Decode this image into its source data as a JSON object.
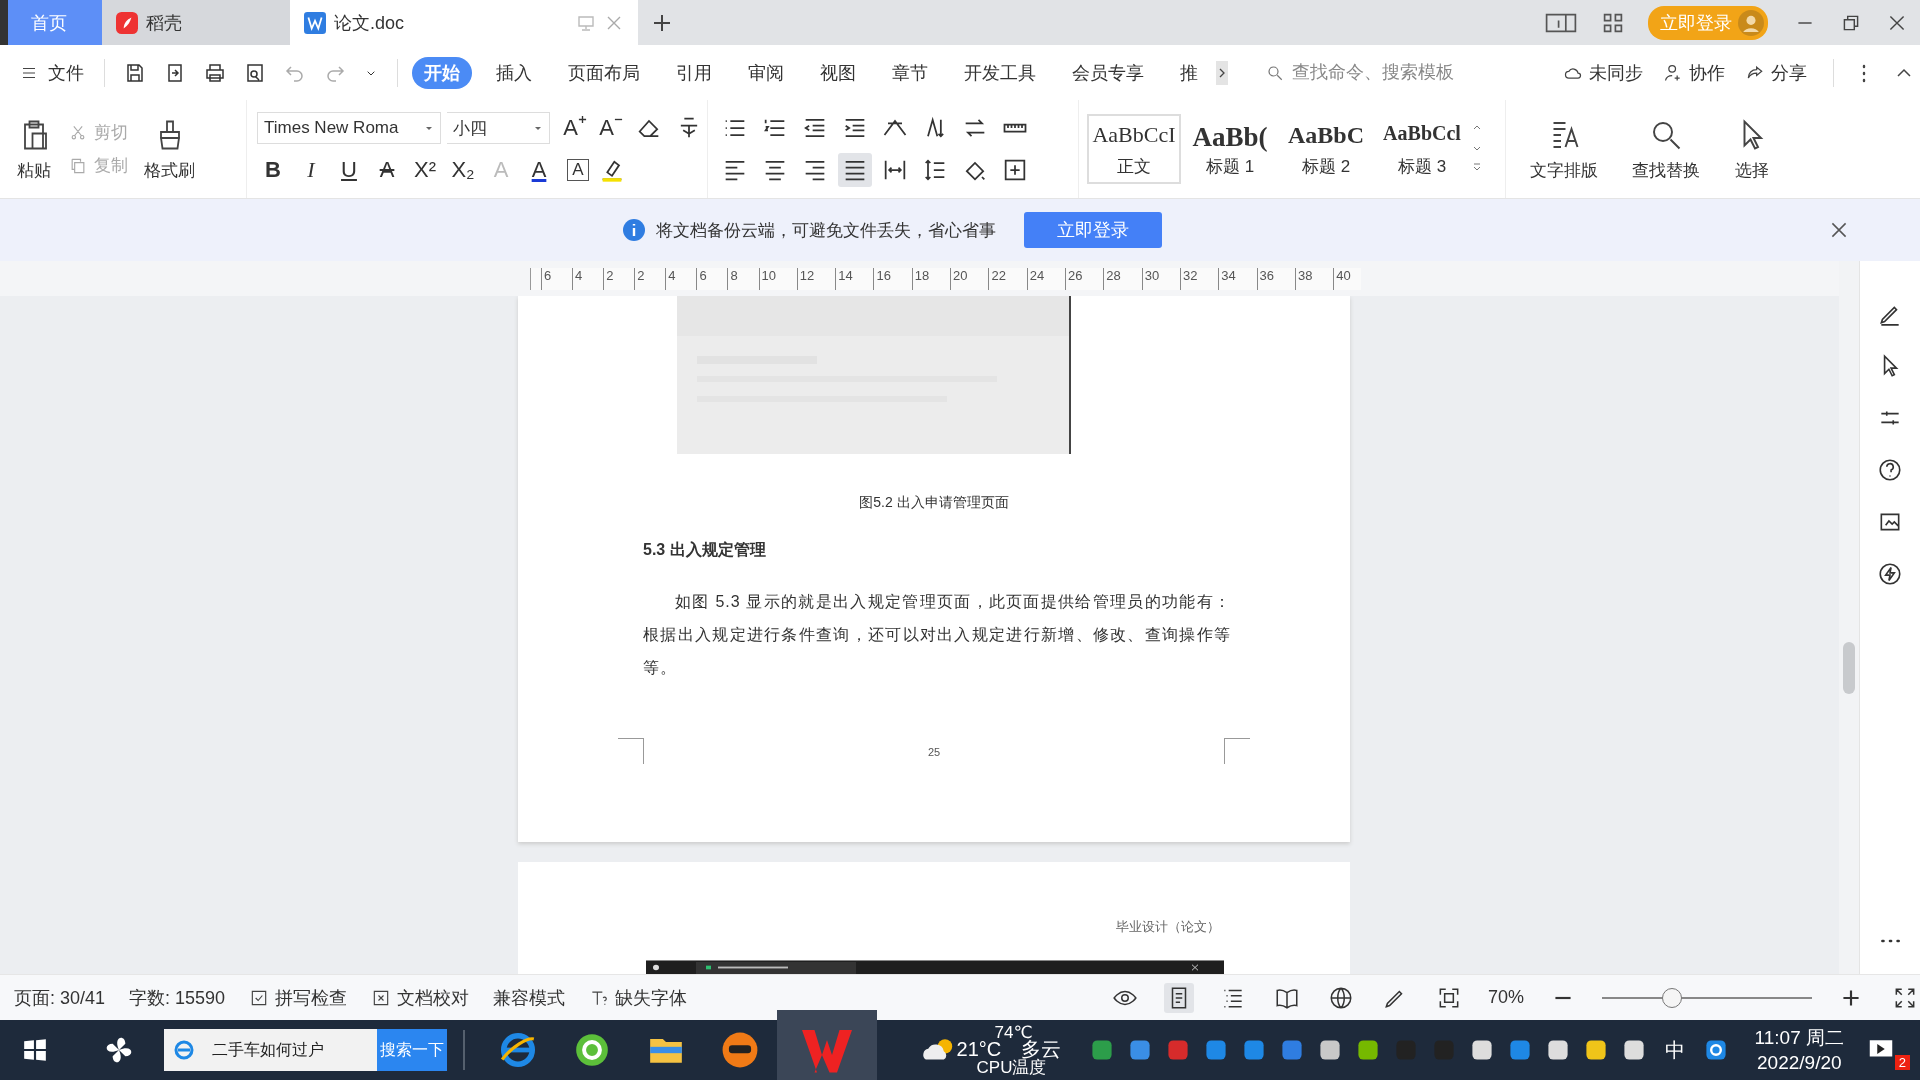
{
  "tabs": [
    {
      "label": "首页",
      "kind": "home",
      "selected": false
    },
    {
      "label": "稻壳",
      "kind": "app",
      "selected": false
    },
    {
      "label": "论文.doc",
      "kind": "doc",
      "selected": true
    }
  ],
  "title_bar": {
    "login_button": "立即登录"
  },
  "menu": {
    "file": "文件",
    "tabs": [
      {
        "label": "开始",
        "selected": true
      },
      {
        "label": "插入",
        "selected": false
      },
      {
        "label": "页面布局",
        "selected": false
      },
      {
        "label": "引用",
        "selected": false
      },
      {
        "label": "审阅",
        "selected": false
      },
      {
        "label": "视图",
        "selected": false
      },
      {
        "label": "章节",
        "selected": false
      },
      {
        "label": "开发工具",
        "selected": false
      },
      {
        "label": "会员专享",
        "selected": false
      },
      {
        "label": "推",
        "selected": false
      }
    ],
    "search": {
      "placeholder": "查找命令、搜索模板"
    },
    "actions": [
      {
        "label": "未同步",
        "kind": "cloud"
      },
      {
        "label": "协作",
        "kind": "user"
      },
      {
        "label": "分享",
        "kind": "share"
      }
    ]
  },
  "ribbon": {
    "clipboard": [
      {
        "label": "剪切",
        "kind": "cut",
        "disabled": true
      },
      {
        "label": "复制",
        "kind": "copy",
        "disabled": true
      }
    ],
    "paste": "粘贴",
    "format_painter": "格式刷",
    "font": {
      "name": "Times New Roma",
      "size": "小四"
    },
    "size_buttons": [
      {
        "glyph": "A",
        "kind": "grow"
      },
      {
        "glyph": "A",
        "kind": "shrink"
      }
    ],
    "text_format": [
      {
        "glyph": "B",
        "kind": "bold"
      },
      {
        "glyph": "I",
        "kind": "italic"
      },
      {
        "glyph": "U",
        "kind": "underline"
      },
      {
        "glyph": "A",
        "kind": "strike"
      },
      {
        "glyph": "X²",
        "kind": "plain"
      },
      {
        "glyph": "X₂",
        "kind": "plain"
      },
      {
        "glyph": "A",
        "kind": "effect"
      },
      {
        "glyph": "A",
        "kind": "color"
      },
      {
        "glyph": "A",
        "kind": "boxed"
      }
    ],
    "styles": [
      {
        "preview": "AaBbCcI",
        "label": "正文",
        "kind": "body",
        "selected": true
      },
      {
        "preview": "AaBb(",
        "label": "标题 1",
        "kind": "h1",
        "selected": false
      },
      {
        "preview": "AaBbC",
        "label": "标题 2",
        "kind": "h2",
        "selected": false
      },
      {
        "preview": "AaBbCcl",
        "label": "标题 3",
        "kind": "h3",
        "selected": false
      }
    ],
    "tools": [
      {
        "label": "文字排版",
        "kind": "layout"
      },
      {
        "label": "查找替换",
        "kind": "find"
      },
      {
        "label": "选择",
        "kind": "select"
      }
    ]
  },
  "notice": {
    "text": "将文档备份云端，可避免文件丢失，省心省事",
    "button": "立即登录"
  },
  "ruler": [
    "6",
    "4",
    "2",
    "2",
    "4",
    "6",
    "8",
    "10",
    "12",
    "14",
    "16",
    "18",
    "20",
    "22",
    "24",
    "26",
    "28",
    "30",
    "32",
    "34",
    "36",
    "38",
    "40"
  ],
  "document": {
    "caption": "图5.2 出入申请管理页面",
    "heading": "5.3 出入规定管理",
    "paragraph": "如图 5.3 显示的就是出入规定管理页面，此页面提供给管理员的功能有：根据出入规定进行条件查询，还可以对出入规定进行新增、修改、查询操作等等。",
    "page_number": "25",
    "header": "毕业设计（论文）"
  },
  "status_bar": {
    "page": "页面: 30/41",
    "words": "字数: 15590",
    "items": [
      {
        "label": "拼写检查",
        "kind": "spell"
      },
      {
        "label": "文档校对",
        "kind": "proof"
      },
      {
        "label": "兼容模式",
        "kind": "plain"
      },
      {
        "label": "缺失字体",
        "kind": "font"
      }
    ],
    "zoom": "70%",
    "zoom_slider": {
      "level": 0.33
    }
  },
  "taskbar": {
    "search": {
      "value": "二手车如何过户"
    },
    "search_button": "搜索一下",
    "cpu": {
      "temp": "74℃",
      "label": "CPU温度"
    },
    "weather": {
      "temp": "21°C",
      "desc": "多云"
    },
    "ime": "中",
    "clock": {
      "time": "11:07 周二",
      "date": "2022/9/20"
    },
    "notification_count": "2"
  }
}
